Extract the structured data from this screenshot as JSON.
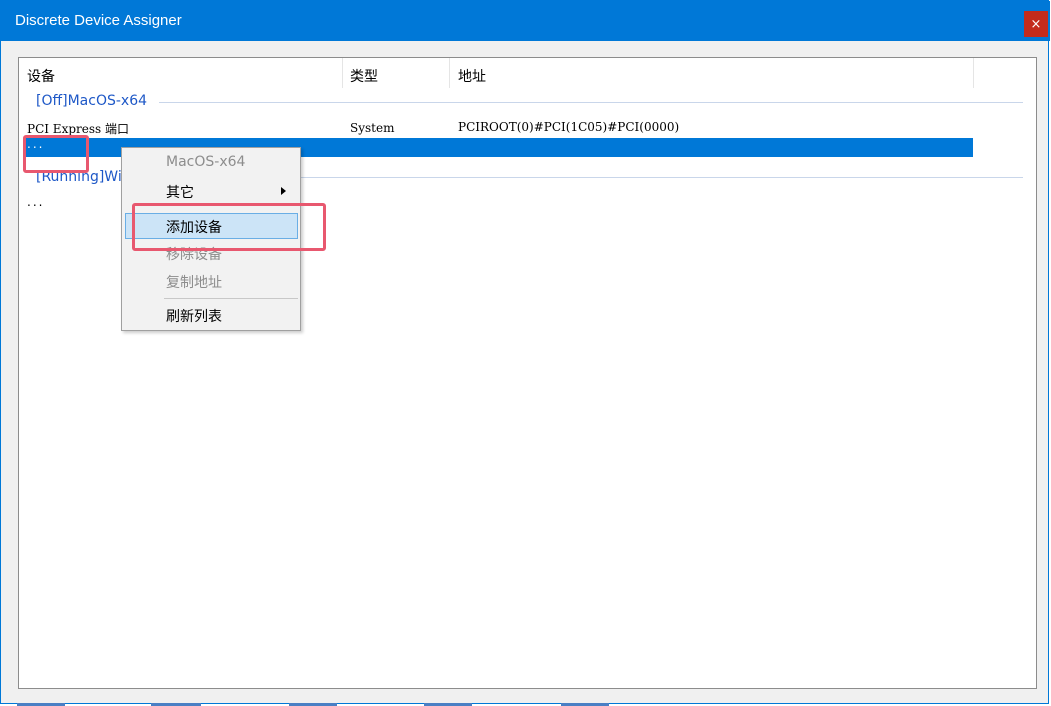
{
  "window": {
    "title": "Discrete Device Assigner",
    "close_label": "×"
  },
  "columns": [
    "设备",
    "类型",
    "地址"
  ],
  "groups": [
    {
      "header": "[Off]MacOS-x64",
      "rows": [
        {
          "device": "PCI Express 端口",
          "type": "System",
          "address": "PCIROOT(0)#PCI(1C05)#PCI(0000)"
        },
        {
          "device": "...",
          "type": "",
          "address": ""
        }
      ]
    },
    {
      "header": "[Running]Wi",
      "rows": [
        {
          "device": "...",
          "type": "",
          "address": ""
        }
      ]
    }
  ],
  "context_menu": {
    "title": "MacOS-x64",
    "items": [
      {
        "label": "其它",
        "has_submenu": true,
        "disabled": false
      },
      {
        "label": "添加设备",
        "disabled": false,
        "hovered": true
      },
      {
        "label": "移除设备",
        "disabled": true
      },
      {
        "label": "复制地址",
        "disabled": true
      },
      {
        "label": "刷新列表",
        "disabled": false
      }
    ]
  },
  "colors": {
    "titlebar": "#0078d7",
    "selection": "#0078d7",
    "group_text": "#1e58c7",
    "highlight_box": "#e8586f",
    "close_button": "#c42b1c"
  }
}
